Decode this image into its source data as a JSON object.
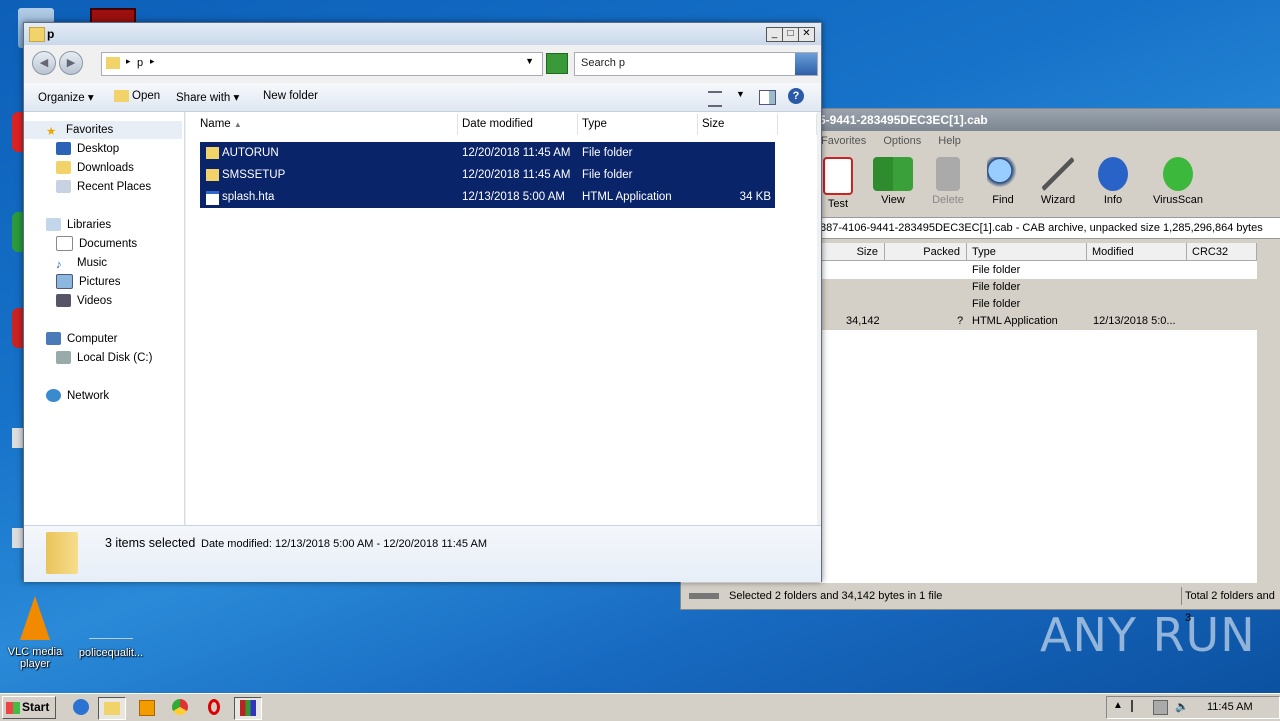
{
  "desktop": {
    "icons": [
      {
        "label": "VLC media player"
      },
      {
        "label": "policequalit..."
      }
    ],
    "watermark": "ANY RUN"
  },
  "zip_window": {
    "title": "5-9441-283495DEC3EC[1].cab",
    "menu": [
      "Favorites",
      "Options",
      "Help"
    ],
    "toolbar": [
      "Test",
      "View",
      "Delete",
      "Find",
      "Wizard",
      "Info",
      "VirusScan"
    ],
    "path": "887-4106-9441-283495DEC3EC[1].cab - CAB archive, unpacked size 1,285,296,864 bytes",
    "columns": [
      "Size",
      "Packed",
      "Type",
      "Modified",
      "CRC32"
    ],
    "rows": [
      {
        "size": "",
        "packed": "",
        "type": "File folder",
        "modified": ""
      },
      {
        "size": "",
        "packed": "",
        "type": "File folder",
        "modified": ""
      },
      {
        "size": "",
        "packed": "",
        "type": "File folder",
        "modified": ""
      },
      {
        "size": "34,142",
        "packed": "?",
        "type": "HTML Application",
        "modified": "12/13/2018 5:0..."
      }
    ],
    "status_selected": "Selected 2 folders and 34,142 bytes in 1 file",
    "status_total": "Total 2 folders and 3"
  },
  "explorer": {
    "title": "p",
    "address": "p",
    "search_placeholder": "Search p",
    "commands": {
      "organize": "Organize",
      "open": "Open",
      "share": "Share with",
      "new_folder": "New folder"
    },
    "nav": {
      "favorites": "Favorites",
      "desktop": "Desktop",
      "downloads": "Downloads",
      "recent": "Recent Places",
      "libraries": "Libraries",
      "documents": "Documents",
      "music": "Music",
      "pictures": "Pictures",
      "videos": "Videos",
      "computer": "Computer",
      "local_disk": "Local Disk (C:)",
      "network": "Network"
    },
    "columns": {
      "name": "Name",
      "date": "Date modified",
      "type": "Type",
      "size": "Size"
    },
    "files": [
      {
        "name": "AUTORUN",
        "date": "12/20/2018 11:45 AM",
        "type": "File folder",
        "size": ""
      },
      {
        "name": "SMSSETUP",
        "date": "12/20/2018 11:45 AM",
        "type": "File folder",
        "size": ""
      },
      {
        "name": "splash.hta",
        "date": "12/13/2018 5:00 AM",
        "type": "HTML Application",
        "size": "34 KB"
      }
    ],
    "details": {
      "count": "3 items selected",
      "date_range": "Date modified: 12/13/2018 5:00 AM - 12/20/2018 11:45 AM"
    }
  },
  "taskbar": {
    "start": "Start",
    "clock": "11:45 AM"
  }
}
